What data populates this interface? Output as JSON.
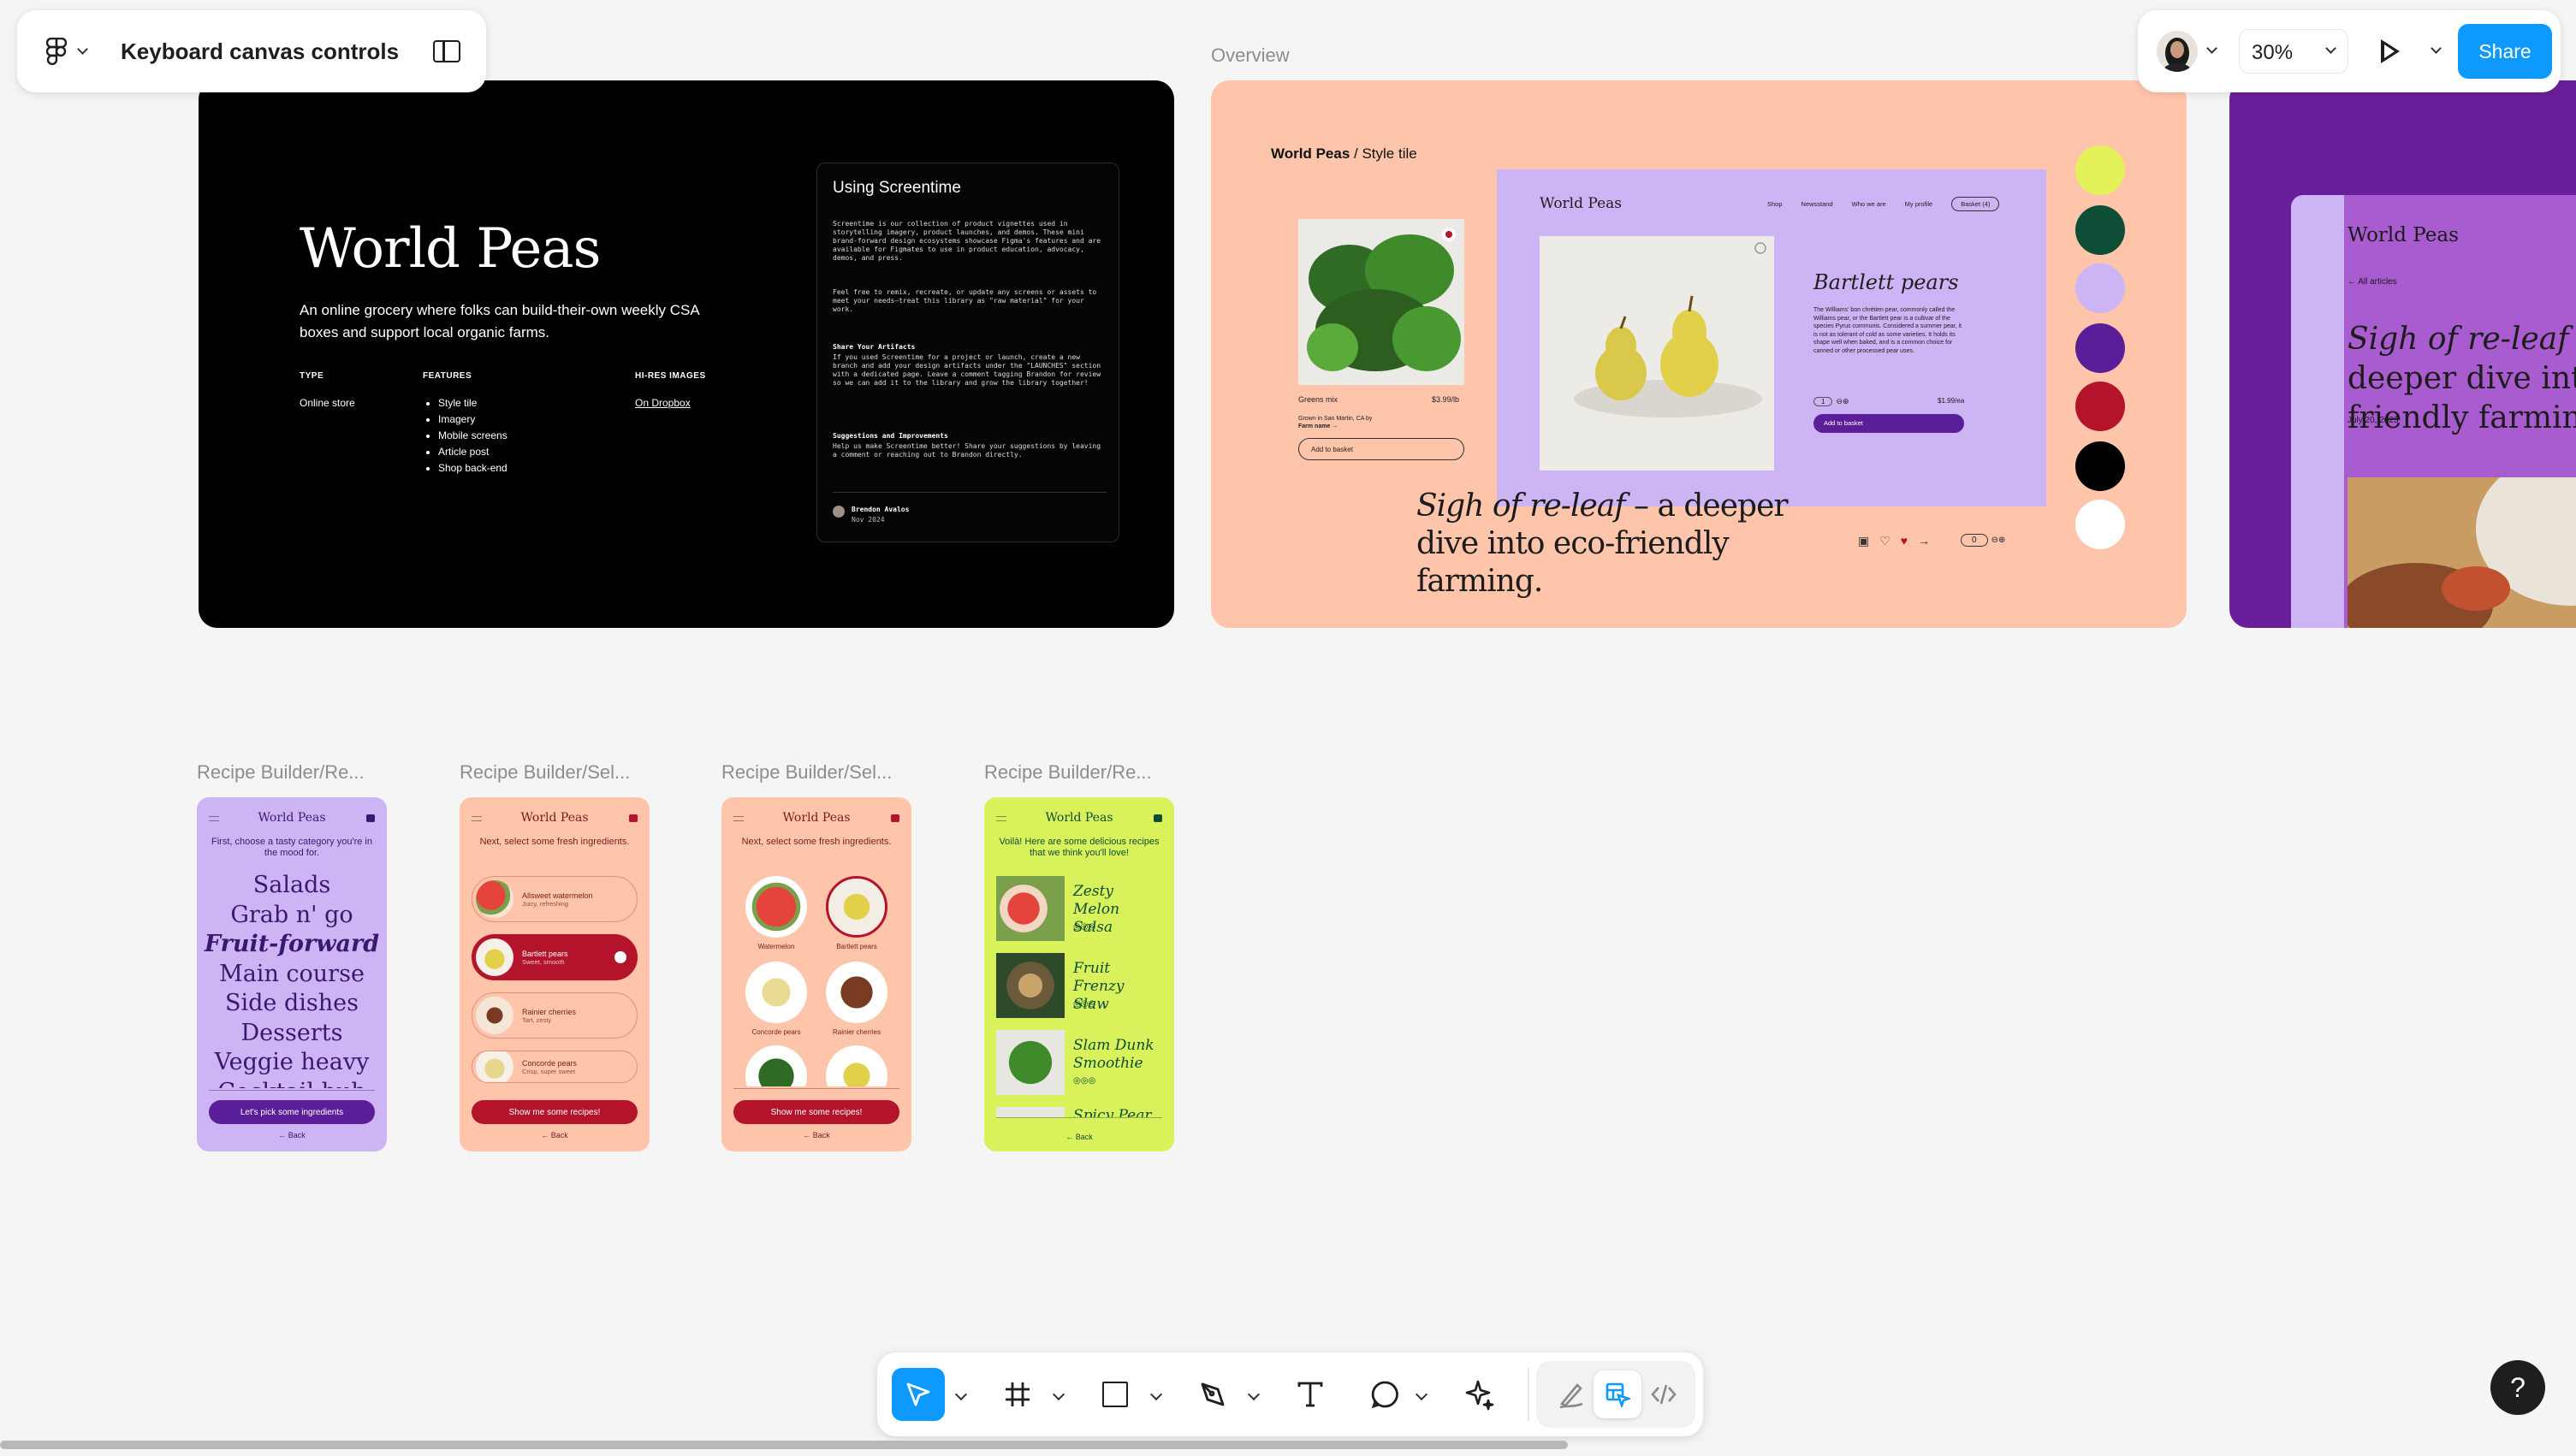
{
  "file": {
    "name": "Keyboard canvas controls"
  },
  "zoom": {
    "label": "30%"
  },
  "share_label": "Share",
  "frames": {
    "overview_label": "Overview"
  },
  "cover": {
    "title": "World Peas",
    "tagline": "An online grocery where folks can build-their-own weekly CSA boxes and support local organic farms.",
    "type_label": "TYPE",
    "type_value": "Online store",
    "features_label": "FEATURES",
    "features": [
      "Style tile",
      "Imagery",
      "Mobile screens",
      "Article post",
      "Shop back-end"
    ],
    "hires_label": "HI-RES IMAGES",
    "hires_link": "On Dropbox",
    "card": {
      "title": "Using Screentime",
      "para1": "Screentime is our collection of product vignettes used in storytelling imagery, product launches, and demos. These mini brand-forward design ecosystems showcase Figma's features and are available for Figmates to use in product education, advocacy, demos, and press.",
      "para2": "Feel free to remix, recreate, or update any screens or assets to meet your needs—treat this library as \"raw material\" for your work.",
      "h2": "Share Your Artifacts",
      "para3": "If you used Screentime for a project or launch, create a new branch and add your design artifacts under the \"LAUNCHES\" section with a dedicated page. Leave a comment tagging Brandon for review so we can add it to the library and grow the library together!",
      "h3": "Suggestions and Improvements",
      "para4": "Help us make Screentime better! Share your suggestions by leaving a comment or reaching out to Brandon directly.",
      "author": "Brendon Avalos",
      "date": "Nov 2024"
    }
  },
  "styletile": {
    "brand": "World Peas",
    "sep": " / ",
    "page": "Style tile",
    "product": {
      "name": "Greens mix",
      "price": "$3.99/lb",
      "origin": "Grown in San Martin, CA by",
      "farm": "Farm name →",
      "cta": "Add to basket"
    },
    "nav": [
      "Shop",
      "Newsstand",
      "Who we are",
      "My profile",
      "Basket (4)"
    ],
    "pear": {
      "title": "Bartlett pears",
      "desc": "The Williams' bon chrétien pear, commonly called the Williams pear, or the Bartlett pear is a cultivar of the species Pyrus communis. Considered a summer pear, it is not as tolerant of cold as some varieties. It holds its shape well when baked, and is a common choice for canned or other processed pear uses.",
      "qty": "1",
      "price": "$1.99/ea",
      "cta": "Add to basket"
    },
    "headline_italic": "Sigh of re-leaf",
    "headline_rest": " – a deeper dive into eco-friendly farming.",
    "stepper": "0",
    "swatches": [
      "#e4f25a",
      "#0e4d36",
      "#cdb4f5",
      "#5a1e99",
      "#b3132b",
      "#000000",
      "#ffffff"
    ]
  },
  "article": {
    "brand": "World Peas",
    "back": "← All articles",
    "headline_italic": "Sigh of re-leaf",
    "headline_rest": " – a deeper dive into eco-friendly farming.",
    "date": "July 20, 2023"
  },
  "recipe_frames": [
    "Recipe Builder/Re...",
    "Recipe Builder/Sel...",
    "Recipe Builder/Sel...",
    "Recipe Builder/Re..."
  ],
  "phone1": {
    "brand": "World Peas",
    "prompt": "First, choose a tasty category you're in the mood for.",
    "items": [
      "Salads",
      "Grab n' go",
      "Fruit-forward",
      "Main course",
      "Side dishes",
      "Desserts",
      "Veggie heavy",
      "Cocktail hub"
    ],
    "cta": "Let's pick some ingredients",
    "back": "← Back"
  },
  "phone2": {
    "brand": "World Peas",
    "prompt": "Next, select some fresh ingredients.",
    "items": [
      {
        "name": "Allsweet watermelon",
        "sub": "Juicy, refreshing"
      },
      {
        "name": "Bartlett pears",
        "sub": "Sweet, smooth"
      },
      {
        "name": "Rainier cherries",
        "sub": "Tart, zesty"
      },
      {
        "name": "Concorde pears",
        "sub": "Crisp, super sweet"
      }
    ],
    "cta": "Show me some recipes!",
    "back": "← Back"
  },
  "phone3": {
    "brand": "World Peas",
    "prompt": "Next, select some fresh ingredients.",
    "items": [
      "Watermelon",
      "Bartlett pears",
      "Concorde pears",
      "Rainier cherries"
    ],
    "cta": "Show me some recipes!",
    "back": "← Back"
  },
  "phone4": {
    "brand": "World Peas",
    "prompt": "Voilà! Here are some delicious recipes that we think you'll love!",
    "recipes": [
      "Zesty Melon Salsa",
      "Fruit Frenzy Slaw",
      "Slam Dunk Smoothie",
      "Spicy Pear"
    ],
    "back": "← Back"
  },
  "icons": {
    "figma": "figma-logo-icon",
    "sidebar": "sidebar-toggle-icon",
    "avatar": "user-avatar",
    "play": "present-play-icon",
    "move": "move-cursor-icon",
    "frame": "frame-hash-icon",
    "rect": "rectangle-icon",
    "pen": "pen-tool-icon",
    "text": "text-tool-icon",
    "comment": "comment-bubble-icon",
    "ai": "ai-sparkle-icon",
    "draw": "draw-mode-icon",
    "design": "design-mode-icon",
    "dev": "dev-mode-code-icon",
    "help": "help-question-icon"
  },
  "colors": {
    "accent": "#0d99ff",
    "cover_bg": "#000000",
    "styletile_bg": "#ffc5ab",
    "lilac": "#cdb4f5",
    "purple": "#6a1f9a",
    "lime": "#d9f15a",
    "red": "#b3132b"
  }
}
